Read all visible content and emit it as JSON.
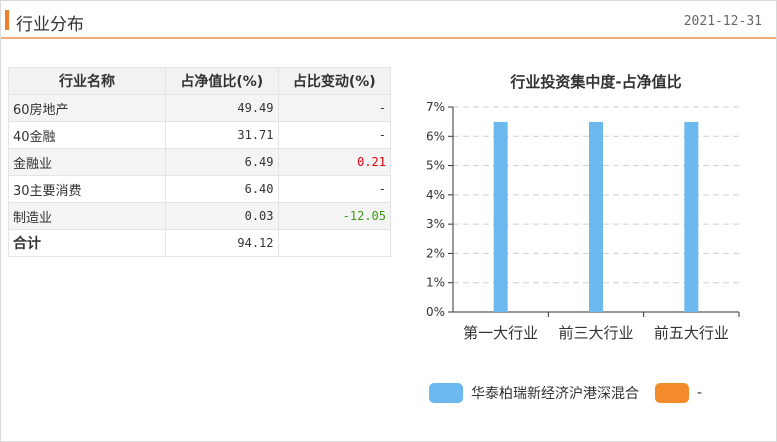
{
  "header": {
    "title": "行业分布",
    "date": "2021-12-31"
  },
  "table": {
    "headers": [
      "行业名称",
      "占净值比(%)",
      "占比变动(%)"
    ],
    "rows": [
      {
        "name": "60房地产",
        "ratio": "49.49",
        "change": "-"
      },
      {
        "name": "40金融",
        "ratio": "31.71",
        "change": "-"
      },
      {
        "name": "金融业",
        "ratio": "6.49",
        "change": "0.21"
      },
      {
        "name": "30主要消费",
        "ratio": "6.40",
        "change": "-"
      },
      {
        "name": "制造业",
        "ratio": "0.03",
        "change": "-12.05"
      }
    ],
    "total": {
      "name": "合计",
      "ratio": "94.12",
      "change": ""
    }
  },
  "colors": {
    "positive": "#e3000b",
    "negative": "#3a9a1a",
    "accent": "#f07d2a"
  },
  "chart_data": {
    "type": "bar",
    "title": "行业投资集中度-占净值比",
    "categories": [
      "第一大行业",
      "前三大行业",
      "前五大行业"
    ],
    "series": [
      {
        "name": "华泰柏瑞新经济沪港深混合",
        "values": [
          6.49,
          6.49,
          6.49
        ],
        "color": "#6cb9f0"
      },
      {
        "name": "-",
        "values": [],
        "color": "#f38b2b"
      }
    ],
    "yticks": [
      "0%",
      "1%",
      "2%",
      "3%",
      "4%",
      "5%",
      "6%",
      "7%"
    ],
    "ylim": [
      0,
      7
    ],
    "grid": true,
    "legend": "bottom"
  }
}
